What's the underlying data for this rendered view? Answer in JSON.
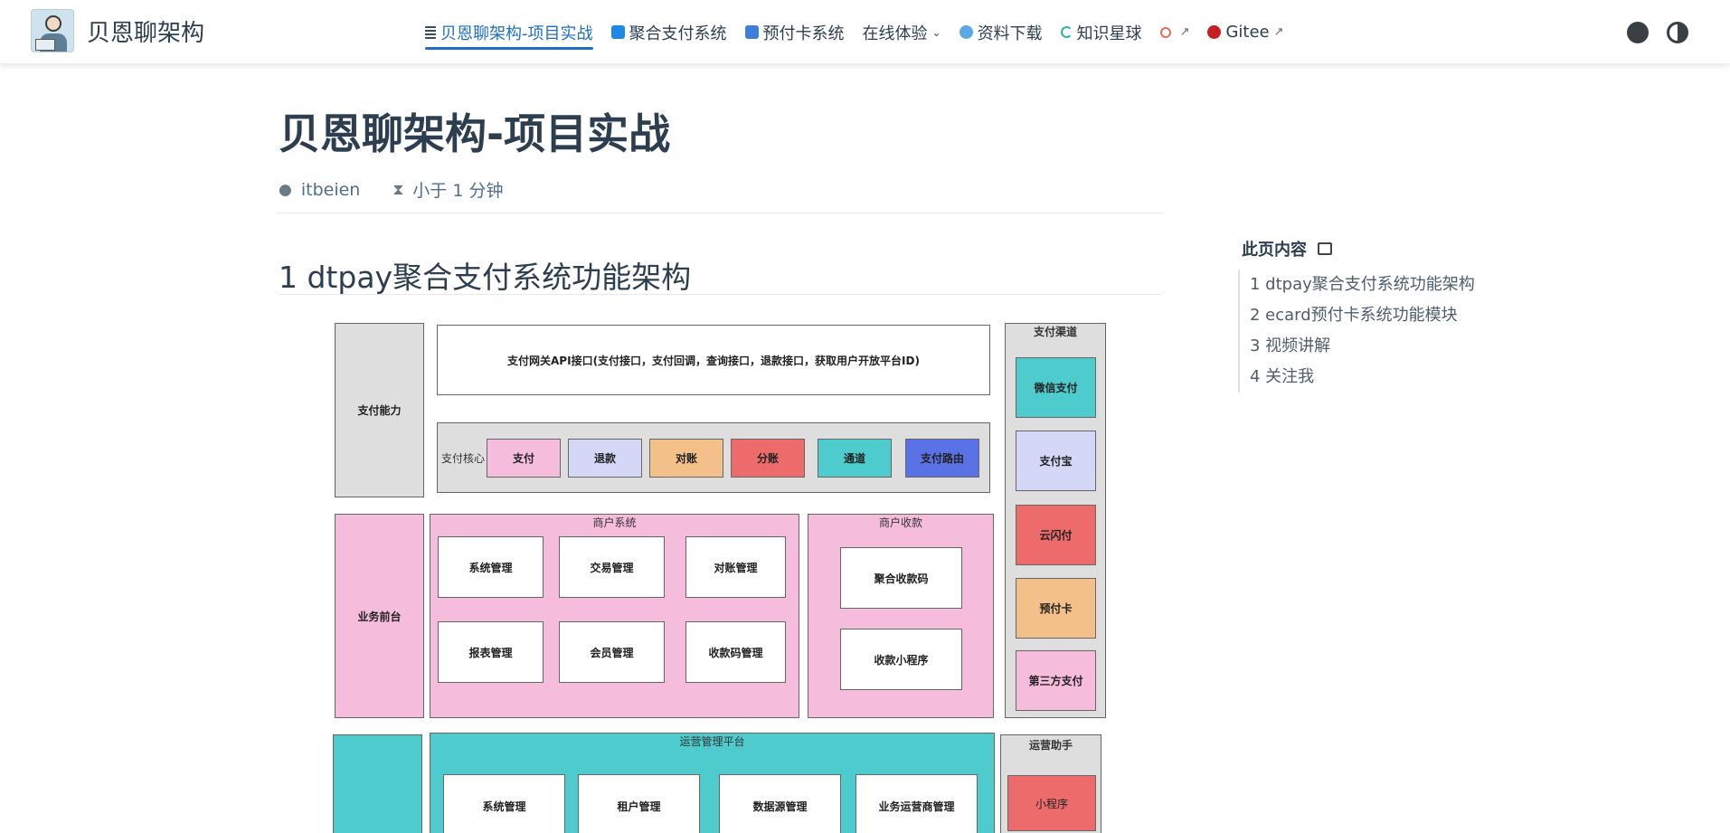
{
  "brand": {
    "name": "贝恩聊架构"
  },
  "nav": [
    {
      "label": "贝恩聊架构-项目实战",
      "icon": "document-list-icon",
      "active": true
    },
    {
      "label": "聚合支付系统",
      "icon": "payment-icon"
    },
    {
      "label": "预付卡系统",
      "icon": "card-icon"
    },
    {
      "label": "在线体验",
      "icon": "chevron-down-icon"
    },
    {
      "label": "资料下载",
      "icon": "cloud-icon"
    },
    {
      "label": "知识星球",
      "icon": "loading-ring-icon"
    },
    {
      "label": "",
      "icon": "link-icon",
      "external": "↗"
    },
    {
      "label": "Gitee",
      "icon": "gitee-icon",
      "external": "↗"
    }
  ],
  "tools": {
    "github": "github-icon",
    "theme": "theme-toggle-icon"
  },
  "page": {
    "title": "贝恩聊架构-项目实战",
    "author": "itbeien",
    "read_time": "小于 1 分钟",
    "section_title": "1 dtpay聚合支付系统功能架构"
  },
  "toc": {
    "title": "此页内容",
    "items": [
      "1 dtpay聚合支付系统功能架构",
      "2 ecard预付卡系统功能模块",
      "3 视频讲解",
      "4 关注我"
    ]
  },
  "diagram": {
    "pay_capability": "支付能力",
    "gateway": "支付网关API接口(支付接口，支付回调，查询接口，退款接口，获取用户开放平台ID)",
    "core_label": "支付核心",
    "core_items": [
      "支付",
      "退款",
      "对账",
      "分账",
      "通道",
      "支付路由"
    ],
    "channels_title": "支付渠道",
    "channels": [
      "微信支付",
      "支付宝",
      "云闪付",
      "预付卡",
      "第三方支付"
    ],
    "business_front": "业务前台",
    "merchant_system": {
      "title": "商户系统",
      "items": [
        "系统管理",
        "交易管理",
        "对账管理",
        "报表管理",
        "会员管理",
        "收款码管理"
      ]
    },
    "merchant_collect": {
      "title": "商户收款",
      "items": [
        "聚合收款码",
        "收款小程序"
      ]
    },
    "ops_platform": {
      "title": "运营管理平台",
      "items": [
        "系统管理",
        "租户管理",
        "数据源管理",
        "业务运营商管理"
      ]
    },
    "ops_assistant": {
      "title": "运营助手",
      "items": [
        "小程序"
      ]
    }
  }
}
